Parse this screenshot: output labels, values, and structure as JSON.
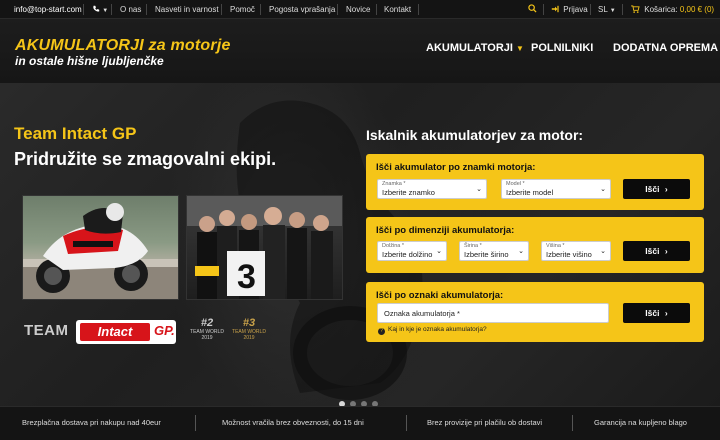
{
  "topbar": {
    "email": "info@top-start.com",
    "phone_icon": "phone-icon",
    "links": [
      "O nas",
      "Nasveti in varnost",
      "Pomoč",
      "Pogosta vprašanja",
      "Novice",
      "Kontakt"
    ],
    "login": "Prijava",
    "language": "SL",
    "cart_label": "Košarica:",
    "cart_value": "0,00 € (0)"
  },
  "header": {
    "logo_line1": "AKUMULATORJI za motorje",
    "logo_line2": "in ostale hišne ljubljenčke",
    "nav": [
      {
        "label": "AKUMULATORJI",
        "dropdown": true
      },
      {
        "label": "POLNILNIKI",
        "dropdown": false
      },
      {
        "label": "DODATNA OPREMA",
        "dropdown": true
      }
    ]
  },
  "hero": {
    "title": "Team Intact GP",
    "subtitle": "Pridružite se zmagovalni ekipi.",
    "team_word": "TEAM",
    "intact_word": "Intact",
    "gp_word": "GP.",
    "badges": [
      {
        "num": "#2",
        "text": "TEAM WORLD 2019"
      },
      {
        "num": "#3",
        "text": "TEAM WORLD 2019"
      }
    ],
    "photo2_number": "3"
  },
  "search": {
    "title": "Iskalnik akumulatorjev za motor:",
    "brand": {
      "heading": "Išči akumulator po znamki motorja:",
      "make_label": "Znamka *",
      "make_value": "Izberite znamko",
      "model_label": "Model *",
      "model_value": "Izberite model",
      "button": "Išči"
    },
    "dimensions": {
      "heading": "Išči po dimenziji akumulatorja:",
      "length_label": "Dolžina *",
      "length_value": "Izberite dolžino",
      "width_label": "Širina *",
      "width_value": "Izberite širino",
      "height_label": "Višina *",
      "height_value": "Izberite višino",
      "button": "Išči"
    },
    "code": {
      "heading": "Išči po oznaki akumulatorja:",
      "value": "Oznaka akumulatorja *",
      "button": "Išči",
      "help": "Kaj in kje je oznaka akumulatorja?"
    }
  },
  "slider": {
    "count": 4,
    "active": 1
  },
  "benefits": [
    "Brezplačna dostava pri nakupu nad 40eur",
    "Možnost vračila brez obveznosti, do 15 dni",
    "Brez provizije pri plačilu ob dostavi",
    "Garancija na kupljeno blago"
  ],
  "colors": {
    "accent": "#f5c518",
    "brand_red": "#d7141a",
    "dark": "#141414"
  }
}
